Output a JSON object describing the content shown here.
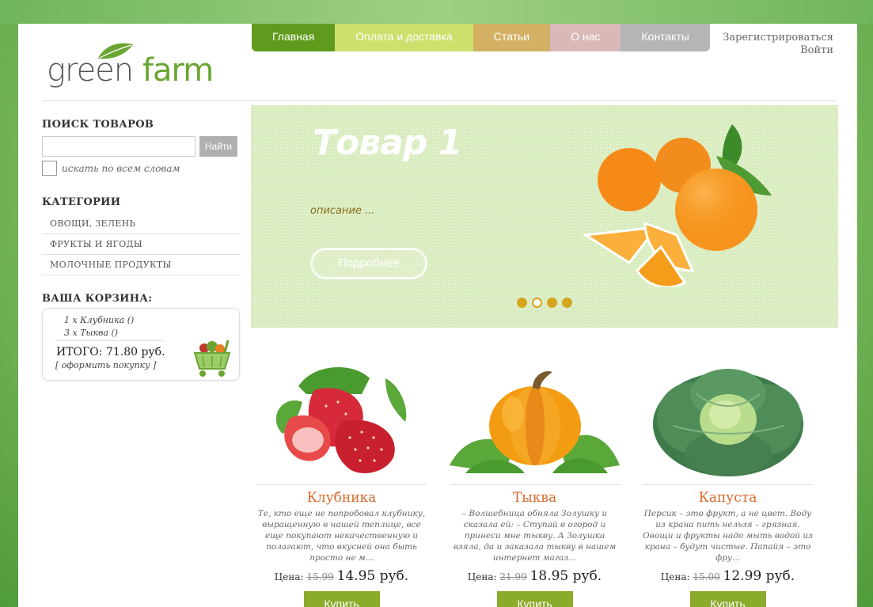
{
  "logo": {
    "word1": "green",
    "word2": "farm"
  },
  "nav": {
    "items": [
      {
        "label": "Главная",
        "color": "#5f9b1c"
      },
      {
        "label": "Оплата и доставка",
        "color": "#cde06c"
      },
      {
        "label": "Статьи",
        "color": "#d3b064"
      },
      {
        "label": "О нас",
        "color": "#d9b8b8"
      },
      {
        "label": "Контакты",
        "color": "#b5b5b5"
      }
    ]
  },
  "auth": {
    "register": "Зарегистрироваться",
    "login": "Войти"
  },
  "sidebar": {
    "search": {
      "heading": "ПОИСК ТОВАРОВ",
      "button": "Найти",
      "checkbox_label": "искать по всем словам"
    },
    "categories": {
      "heading": "КАТЕГОРИИ",
      "items": [
        "ОВОЩИ, ЗЕЛЕНЬ",
        "ФРУКТЫ И ЯГОДЫ",
        "МОЛОЧНЫЕ ПРОДУКТЫ"
      ]
    },
    "cart": {
      "heading": "ВАША КОРЗИНА:",
      "lines": [
        "1 x Клубника ()",
        "3 x Тыква ()"
      ],
      "total": "ИТОГО: 71.80 руб.",
      "checkout": "[ оформить покупку ]"
    }
  },
  "slider": {
    "title": "Товар 1",
    "description": "описание ...",
    "button": "Подробнее",
    "slides_total": 4,
    "active_slide": 2
  },
  "products": [
    {
      "title": "Клубника",
      "description": "Те, кто еще не попробовал клубнику, выращенную в нашей теплице, все еще покупают некачественную и полагают, что вкусней она быть просто не м...",
      "price_label": "Цена:",
      "old_price": "15.99",
      "new_price": "14.95 руб.",
      "buy": "Купить"
    },
    {
      "title": "Тыква",
      "description": "– Волшебница обняла Золушку и сказала ей: – Ступай в огород и принеси мне тыкву. А Золушка взяла, да и заказала тыкву в нашем интернет магаз...",
      "price_label": "Цена:",
      "old_price": "21.99",
      "new_price": "18.95 руб.",
      "buy": "Купить"
    },
    {
      "title": "Капуста",
      "description": "Персик – это фрукт, а не цвет. Воду из крана пить нельзя – грязная. Овощи и фрукты надо мыть водой из крана – будут чистые. Папайя – это фру...",
      "price_label": "Цена:",
      "old_price": "15.00",
      "new_price": "12.99 руб.",
      "buy": "Купить"
    }
  ]
}
